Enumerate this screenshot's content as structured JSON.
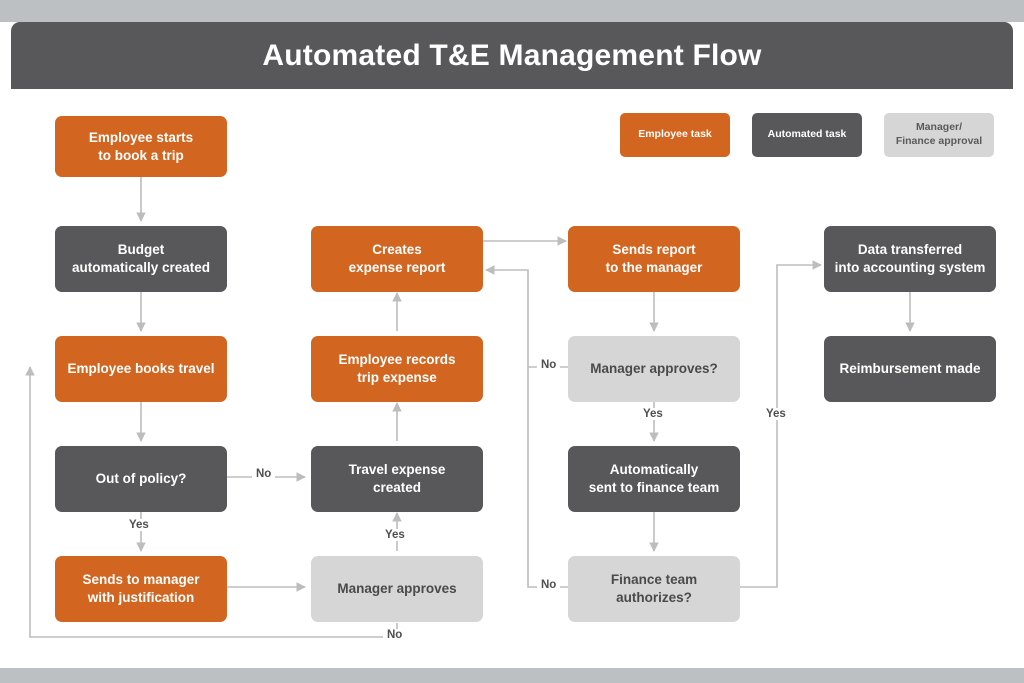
{
  "header": {
    "title": "Automated T&E Management Flow",
    "bar_color": "#58575a",
    "band_color": "#bcc0c3"
  },
  "palette": {
    "employee_task": "#d2651f",
    "automated_task": "#58575a",
    "approval": "#d6d6d6",
    "connector": "#bdbdbd",
    "page_background": "#ffffff"
  },
  "legend": {
    "items": [
      {
        "label": "Employee task",
        "type": "employee"
      },
      {
        "label": "Automated task",
        "type": "automated"
      },
      {
        "label": "Manager/\nFinance approval",
        "line1": "Manager/",
        "line2": "Finance approval",
        "type": "approval"
      }
    ]
  },
  "nodes": [
    {
      "id": "employee-starts-to-book-a-trip",
      "line1": "Employee starts",
      "line2": "to book a trip",
      "type": "employee"
    },
    {
      "id": "budget-automatically-created",
      "line1": "Budget",
      "line2": "automatically created",
      "type": "automated"
    },
    {
      "id": "employee-books-travel",
      "line1": "Employee books travel",
      "line2": "",
      "type": "employee"
    },
    {
      "id": "out-of-policy",
      "line1": "Out of policy?",
      "line2": "",
      "type": "automated"
    },
    {
      "id": "sends-to-manager-with-justification",
      "line1": "Sends to manager",
      "line2": "with justification",
      "type": "employee"
    },
    {
      "id": "creates-expense-report",
      "line1": "Creates",
      "line2": "expense report",
      "type": "employee"
    },
    {
      "id": "employee-records-trip-expense",
      "line1": "Employee records",
      "line2": "trip expense",
      "type": "employee"
    },
    {
      "id": "travel-expense-created",
      "line1": "Travel expense",
      "line2": "created",
      "type": "automated"
    },
    {
      "id": "manager-approves",
      "line1": "Manager approves",
      "line2": "",
      "type": "approval"
    },
    {
      "id": "sends-report-to-the-manager",
      "line1": "Sends report",
      "line2": "to the manager",
      "type": "employee"
    },
    {
      "id": "manager-approves-question",
      "line1": "Manager approves?",
      "line2": "",
      "type": "approval"
    },
    {
      "id": "automatically-sent-to-finance-team",
      "line1": "Automatically",
      "line2": "sent to finance team",
      "type": "automated"
    },
    {
      "id": "finance-team-authorizes",
      "line1": "Finance team",
      "line2": "authorizes?",
      "type": "approval"
    },
    {
      "id": "data-transferred-into-accounting-system",
      "line1": "Data transferred",
      "line2": "into accounting system",
      "type": "automated"
    },
    {
      "id": "reimbursement-made",
      "line1": "Reimbursement made",
      "line2": "",
      "type": "automated"
    }
  ],
  "edge_labels": [
    {
      "id": "out-of-policy-no",
      "text": "No"
    },
    {
      "id": "out-of-policy-yes",
      "text": "Yes"
    },
    {
      "id": "manager-approves-yes",
      "text": "Yes"
    },
    {
      "id": "manager-approves-no",
      "text": "No"
    },
    {
      "id": "manager-approves-question-no",
      "text": "No"
    },
    {
      "id": "manager-approves-question-yes",
      "text": "Yes"
    },
    {
      "id": "finance-team-authorizes-no",
      "text": "No"
    },
    {
      "id": "finance-team-authorizes-yes",
      "text": "Yes"
    }
  ]
}
